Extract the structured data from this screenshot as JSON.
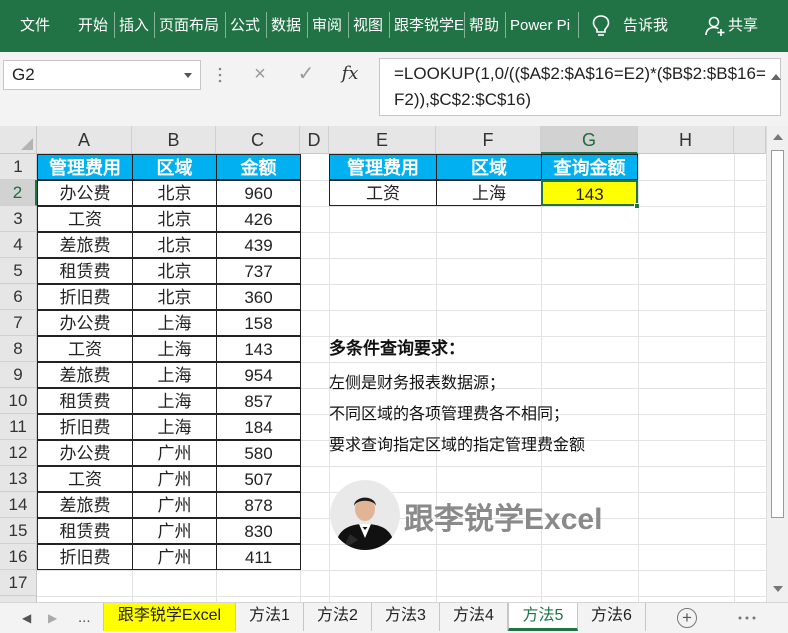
{
  "ribbon": {
    "tabs": [
      "文件",
      "开始",
      "插入",
      "页面布局",
      "公式",
      "数据",
      "审阅",
      "视图",
      "跟李锐学E",
      "帮助",
      "Power Pi"
    ],
    "tell_me": "告诉我",
    "share": "共享",
    "bg_color": "#217346"
  },
  "formula_bar": {
    "name_box": "G2",
    "cancel_icon": "×",
    "enter_icon": "✓",
    "fx_label": "fx",
    "formula": "=LOOKUP(1,0/(($A$2:$A$16=E2)*($B$2:$B$16=F2)),$C$2:$C$16)"
  },
  "columns": [
    "A",
    "B",
    "C",
    "D",
    "E",
    "F",
    "G",
    "H"
  ],
  "rows": [
    "1",
    "2",
    "3",
    "4",
    "5",
    "6",
    "7",
    "8",
    "9",
    "10",
    "11",
    "12",
    "13",
    "14",
    "15",
    "16",
    "17"
  ],
  "table": {
    "headers": [
      "管理费用",
      "区域",
      "金额"
    ],
    "rows": [
      [
        "办公费",
        "北京",
        "960"
      ],
      [
        "工资",
        "北京",
        "426"
      ],
      [
        "差旅费",
        "北京",
        "439"
      ],
      [
        "租赁费",
        "北京",
        "737"
      ],
      [
        "折旧费",
        "北京",
        "360"
      ],
      [
        "办公费",
        "上海",
        "158"
      ],
      [
        "工资",
        "上海",
        "143"
      ],
      [
        "差旅费",
        "上海",
        "954"
      ],
      [
        "租赁费",
        "上海",
        "857"
      ],
      [
        "折旧费",
        "上海",
        "184"
      ],
      [
        "办公费",
        "广州",
        "580"
      ],
      [
        "工资",
        "广州",
        "507"
      ],
      [
        "差旅费",
        "广州",
        "878"
      ],
      [
        "租赁费",
        "广州",
        "830"
      ],
      [
        "折旧费",
        "广州",
        "411"
      ]
    ]
  },
  "query": {
    "headers": [
      "管理费用",
      "区域",
      "查询金额"
    ],
    "values": [
      "工资",
      "上海",
      "143"
    ]
  },
  "notes": {
    "title": "多条件查询要求：",
    "lines": [
      "左侧是财务报表数据源；",
      "不同区域的各项管理费各不相同；",
      "要求查询指定区域的指定管理费金额"
    ]
  },
  "logo_text": "跟李锐学Excel",
  "sheet_tabs": {
    "ellipsis": "...",
    "tabs": [
      "跟李锐学Excel",
      "方法1",
      "方法2",
      "方法3",
      "方法4",
      "方法5",
      "方法6"
    ],
    "active": "方法5",
    "add": "+"
  },
  "colors": {
    "header_fill": "#00b0f0",
    "highlight": "#ffff00",
    "accent": "#217346"
  }
}
